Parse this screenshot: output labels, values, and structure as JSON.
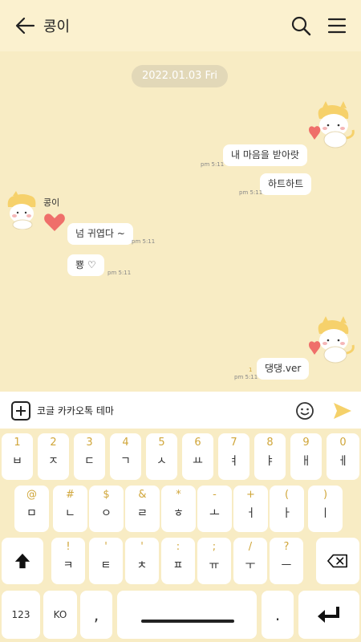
{
  "header": {
    "title": "콩이"
  },
  "chat": {
    "date": "2022.01.03 Fri",
    "sender_name": "콩이",
    "messages": [
      {
        "text": "내 마음을 받아랏",
        "time": "pm 5:11"
      },
      {
        "text": "하트하트",
        "time": "pm 5:11"
      },
      {
        "text": "넘 귀엽다 ~",
        "time": "pm 5:11"
      },
      {
        "text": "뿅 ♡",
        "time": "pm 5:11"
      },
      {
        "text": "댕댕.ver",
        "time": "pm 5:11",
        "read_count": "1"
      }
    ]
  },
  "input": {
    "value": "코글 카카오톡 테마"
  },
  "keyboard": {
    "row1": [
      {
        "top": "1",
        "main": "ㅂ"
      },
      {
        "top": "2",
        "main": "ㅈ"
      },
      {
        "top": "3",
        "main": "ㄷ"
      },
      {
        "top": "4",
        "main": "ㄱ"
      },
      {
        "top": "5",
        "main": "ㅅ"
      },
      {
        "top": "6",
        "main": "ㅛ"
      },
      {
        "top": "7",
        "main": "ㅕ"
      },
      {
        "top": "8",
        "main": "ㅑ"
      },
      {
        "top": "9",
        "main": "ㅐ"
      },
      {
        "top": "0",
        "main": "ㅔ"
      }
    ],
    "row2": [
      {
        "top": "@",
        "main": "ㅁ"
      },
      {
        "top": "#",
        "main": "ㄴ"
      },
      {
        "top": "$",
        "main": "ㅇ"
      },
      {
        "top": "&",
        "main": "ㄹ"
      },
      {
        "top": "*",
        "main": "ㅎ"
      },
      {
        "top": "-",
        "main": "ㅗ"
      },
      {
        "top": "+",
        "main": "ㅓ"
      },
      {
        "top": "(",
        "main": "ㅏ"
      },
      {
        "top": ")",
        "main": "ㅣ"
      }
    ],
    "row3": [
      {
        "top": "!",
        "main": "ㅋ"
      },
      {
        "top": "'",
        "main": "ㅌ"
      },
      {
        "top": "'",
        "main": "ㅊ"
      },
      {
        "top": ":",
        "main": "ㅍ"
      },
      {
        "top": ";",
        "main": "ㅠ"
      },
      {
        "top": "/",
        "main": "ㅜ"
      },
      {
        "top": "?",
        "main": "ㅡ"
      }
    ],
    "mode_123": "123",
    "mode_lang": "KO",
    "comma": ",",
    "period": "."
  },
  "icons": {
    "back": "arrow-left",
    "search": "magnifier",
    "menu": "hamburger",
    "attach": "plus-box",
    "emoji": "smiley",
    "send": "paper-plane",
    "shift": "shift-arrow",
    "backspace": "backspace",
    "enter": "return-arrow"
  },
  "colors": {
    "background": "#f8ecc4",
    "accent_key": "#d0a63a",
    "send": "#f5d16a"
  }
}
